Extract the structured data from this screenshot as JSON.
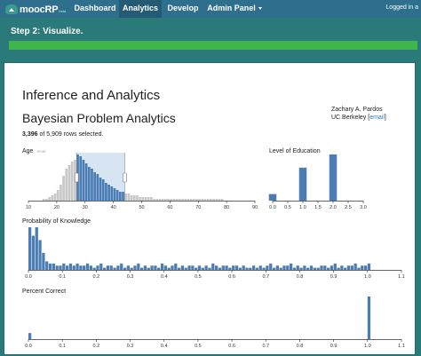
{
  "nav": {
    "logo": "moocRP",
    "logo_beta": "beta",
    "items": [
      {
        "label": "Dashboard",
        "active": false
      },
      {
        "label": "Analytics",
        "active": true
      },
      {
        "label": "Develop",
        "active": false
      },
      {
        "label": "Admin Panel",
        "active": false
      }
    ],
    "login": "Logged in a"
  },
  "step": {
    "title": "Step 2: Visualize."
  },
  "panel": {
    "title": "Inference and Analytics",
    "subtitle": "Bayesian Problem Analytics",
    "author_name": "Zachary A. Pardos",
    "author_org": "UC Berkeley",
    "author_email": "email",
    "rows_selected": "3,396",
    "rows_total": "of 5,909 rows selected."
  },
  "colors": {
    "nav": "#2e6f8e",
    "teal": "#2b7a7a",
    "progress": "#3fb54a",
    "bar": "#4a7db3",
    "bar_bg": "#c8c8c8",
    "brush": "#d7e5f3"
  },
  "chart_data": [
    {
      "type": "bar",
      "title": "Age",
      "reset_label": "reset",
      "xlim": [
        10,
        90
      ],
      "xticks": [
        10,
        20,
        30,
        40,
        50,
        60,
        70,
        80,
        90
      ],
      "brush": [
        27,
        44
      ],
      "bin_width": 1,
      "x": [
        15,
        16,
        17,
        18,
        19,
        20,
        21,
        22,
        23,
        24,
        25,
        26,
        27,
        28,
        29,
        30,
        31,
        32,
        33,
        34,
        35,
        36,
        37,
        38,
        39,
        40,
        41,
        42,
        43,
        44,
        45,
        46,
        47,
        48,
        49,
        50,
        51,
        52,
        53,
        54,
        55,
        56,
        57,
        58,
        59,
        60,
        61,
        62,
        63,
        64,
        65,
        66,
        67,
        68,
        69,
        70,
        71,
        72,
        73,
        74,
        75,
        76,
        77,
        78
      ],
      "values": [
        1,
        1,
        2,
        3,
        4,
        6,
        9,
        14,
        18,
        20,
        22,
        23,
        26,
        25,
        23,
        21,
        19,
        18,
        16,
        15,
        13,
        12,
        10,
        9,
        8,
        7,
        6,
        5,
        5,
        4,
        4,
        3,
        3,
        3,
        2,
        2,
        2,
        2,
        2,
        1,
        1,
        1,
        1,
        1,
        1,
        1,
        1,
        1,
        1,
        1,
        1,
        1,
        1,
        1,
        1,
        1,
        1,
        1,
        1,
        1,
        1,
        1,
        1,
        1
      ],
      "selected": [
        false,
        false,
        false,
        false,
        false,
        false,
        false,
        false,
        false,
        false,
        false,
        false,
        true,
        true,
        true,
        true,
        true,
        true,
        true,
        true,
        true,
        true,
        true,
        true,
        true,
        true,
        true,
        true,
        true,
        false,
        false,
        false,
        false,
        false,
        false,
        false,
        false,
        false,
        false,
        false,
        false,
        false,
        false,
        false,
        false,
        false,
        false,
        false,
        false,
        false,
        false,
        false,
        false,
        false,
        false,
        false,
        false,
        false,
        false,
        false,
        false,
        false,
        false,
        false
      ],
      "ylim": [
        0,
        26
      ]
    },
    {
      "type": "bar",
      "title": "Level of Education",
      "xlim": [
        0,
        3
      ],
      "xticks": [
        "0.0",
        "0.5",
        "1.0",
        "1.5",
        "2.0",
        "2.5",
        "3.0"
      ],
      "bin_width": 0.1,
      "x": [
        0,
        1.0,
        2.0
      ],
      "values": [
        2,
        10,
        14
      ],
      "ylim": [
        0,
        14
      ]
    },
    {
      "type": "bar",
      "title": "Probability of Knowledge",
      "xlim": [
        0,
        1.1
      ],
      "xticks": [
        "0.0",
        "0.1",
        "0.2",
        "0.3",
        "0.4",
        "0.5",
        "0.6",
        "0.7",
        "0.8",
        "0.9",
        "1.0",
        "1.1"
      ],
      "bin_width": 0.01,
      "x": [
        0.0,
        0.01,
        0.02,
        0.03,
        0.04,
        0.05,
        0.06,
        0.07,
        0.08,
        0.09,
        0.1,
        0.11,
        0.12,
        0.13,
        0.14,
        0.15,
        0.16,
        0.17,
        0.18,
        0.19,
        0.2,
        0.21,
        0.22,
        0.23,
        0.24,
        0.25,
        0.26,
        0.27,
        0.28,
        0.29,
        0.3,
        0.31,
        0.32,
        0.33,
        0.34,
        0.35,
        0.36,
        0.37,
        0.38,
        0.39,
        0.4,
        0.41,
        0.42,
        0.43,
        0.44,
        0.45,
        0.46,
        0.47,
        0.48,
        0.49,
        0.5,
        0.51,
        0.52,
        0.53,
        0.54,
        0.55,
        0.56,
        0.57,
        0.58,
        0.59,
        0.6,
        0.61,
        0.62,
        0.63,
        0.64,
        0.65,
        0.66,
        0.67,
        0.68,
        0.69,
        0.7,
        0.71,
        0.72,
        0.73,
        0.74,
        0.75,
        0.76,
        0.77,
        0.78,
        0.79,
        0.8,
        0.81,
        0.82,
        0.83,
        0.84,
        0.85,
        0.86,
        0.87,
        0.88,
        0.89,
        0.9,
        0.91,
        0.92,
        0.93,
        0.94,
        0.95,
        0.96,
        0.97,
        0.98,
        0.99,
        1.0
      ],
      "values": [
        20,
        16,
        20,
        14,
        8,
        4,
        3,
        3,
        2,
        2,
        3,
        2,
        3,
        2,
        3,
        2,
        2,
        3,
        2,
        1,
        2,
        3,
        1,
        2,
        2,
        1,
        2,
        3,
        1,
        2,
        1,
        2,
        3,
        1,
        2,
        1,
        2,
        2,
        1,
        3,
        2,
        1,
        2,
        3,
        1,
        2,
        1,
        2,
        2,
        1,
        2,
        1,
        2,
        1,
        3,
        2,
        1,
        2,
        2,
        1,
        2,
        2,
        1,
        2,
        1,
        1,
        2,
        1,
        2,
        1,
        2,
        3,
        1,
        2,
        1,
        2,
        2,
        3,
        1,
        2,
        1,
        2,
        1,
        2,
        1,
        1,
        2,
        2,
        1,
        2,
        3,
        1,
        2,
        1,
        2,
        2,
        3,
        1,
        2,
        2,
        3
      ],
      "ylim": [
        0,
        20
      ]
    },
    {
      "type": "bar",
      "title": "Percent Correct",
      "xlim": [
        0,
        1.1
      ],
      "xticks": [
        "0.0",
        "0.1",
        "0.2",
        "0.3",
        "0.4",
        "0.5",
        "0.6",
        "0.7",
        "0.8",
        "0.9",
        "1.0",
        "1.1"
      ],
      "bin_width": 0.01,
      "x": [
        0.0,
        1.0
      ],
      "values": [
        2,
        14
      ],
      "ylim": [
        0,
        14
      ]
    }
  ]
}
